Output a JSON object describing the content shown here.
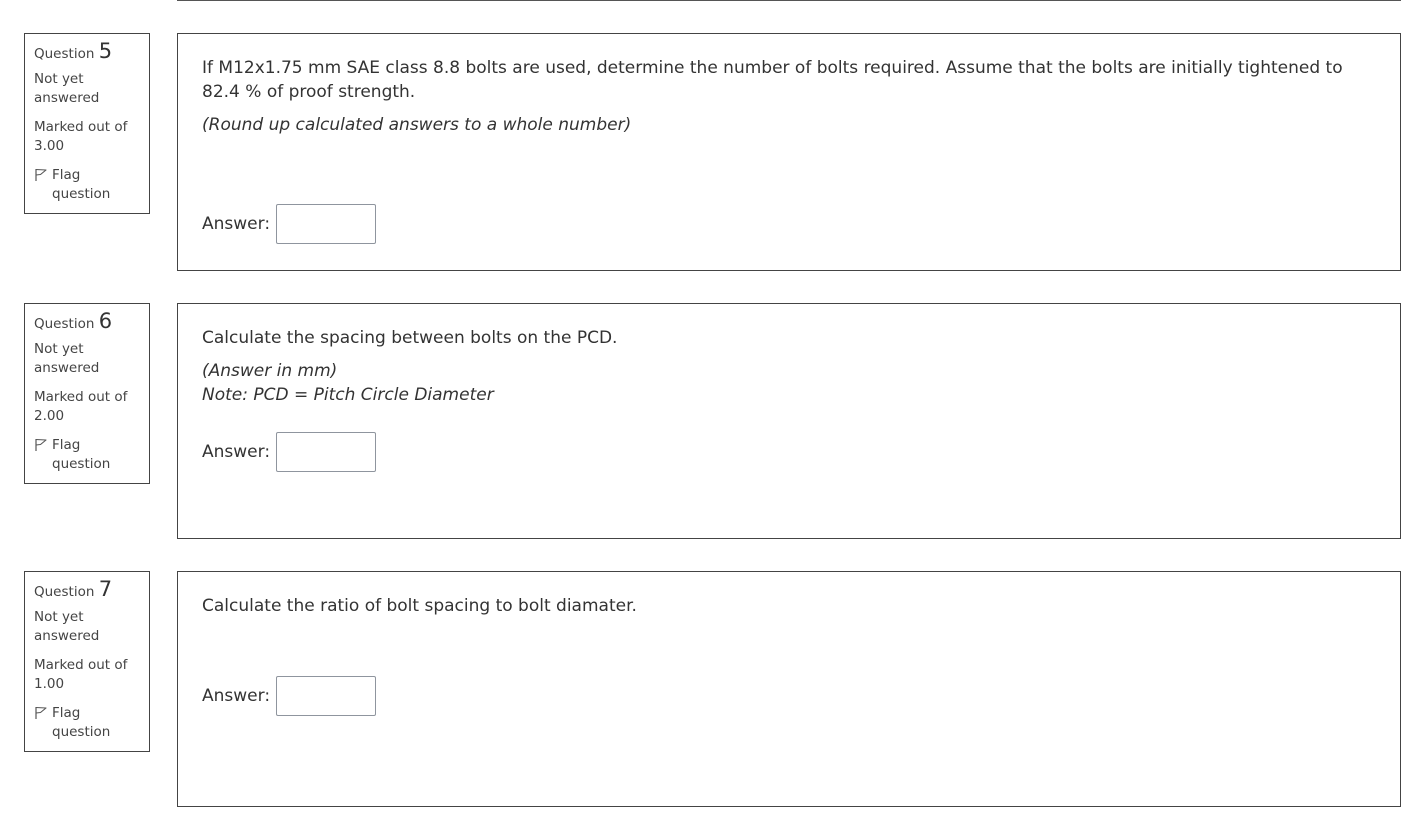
{
  "questions": [
    {
      "prefix": "Question",
      "number": "5",
      "state": "Not yet answered",
      "grade": "Marked out of 3.00",
      "flag_label": "Flag question",
      "text": "If M12x1.75 mm SAE class 8.8 bolts are used, determine the number of bolts required. Assume that the bolts are initially tightened to 82.4 % of proof strength.",
      "hint_lines": [
        "(Round up calculated answers to a whole number)"
      ],
      "answer_label": "Answer:",
      "answer_value": ""
    },
    {
      "prefix": "Question",
      "number": "6",
      "state": "Not yet answered",
      "grade": "Marked out of 2.00",
      "flag_label": "Flag question",
      "text": "Calculate the spacing between bolts on the PCD.",
      "hint_lines": [
        "(Answer in mm)",
        "Note: PCD = Pitch Circle Diameter"
      ],
      "answer_label": "Answer:",
      "answer_value": ""
    },
    {
      "prefix": "Question",
      "number": "7",
      "state": "Not yet answered",
      "grade": "Marked out of 1.00",
      "flag_label": "Flag question",
      "text": "Calculate the ratio of bolt spacing to bolt diamater.",
      "hint_lines": [],
      "answer_label": "Answer:",
      "answer_value": ""
    }
  ],
  "icons": {
    "flag": "flag-outline-icon"
  },
  "colors": {
    "text": "#333333",
    "border": "#444444",
    "input_border": "#8f959e"
  }
}
